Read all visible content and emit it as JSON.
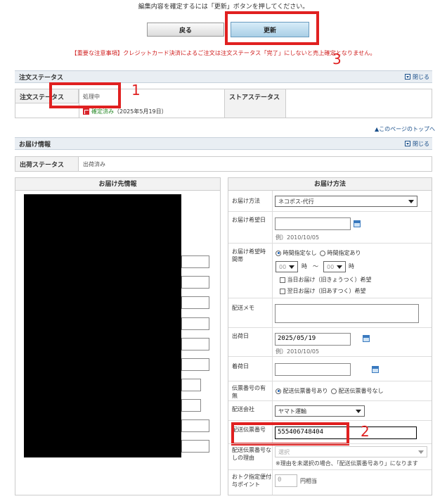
{
  "top_notice": "編集内容を確定するには「更新」ボタンを押してください。",
  "buttons": {
    "back": "戻る",
    "update": "更新"
  },
  "warning": "【重要な注意事項】クレジットカード決済によるご注文は注文ステータス「完了」にしないと売上確定となりません。",
  "annotations": {
    "n1": "1",
    "n2": "2",
    "n3": "3"
  },
  "order_status": {
    "section_title": "注文ステータス",
    "collapse": "閉じる",
    "label": "注文ステータス",
    "value": "処理中",
    "confirmed_text": "確定済み",
    "confirmed_date": "（2025年5月19日）",
    "store_status_label": "ストアステータス"
  },
  "back_to_top": "▲このページのトップへ",
  "delivery": {
    "section_title": "お届け情報",
    "collapse": "閉じる",
    "ship_status_label": "出荷ステータス",
    "ship_status_value": "出荷済み",
    "left_header": "お届け先情報",
    "right_header": "お届け方法"
  },
  "method": {
    "method_label": "お届け方法",
    "method_value": "ネコポス-代行",
    "desired_date_label": "お届け希望日",
    "date_example": "例）2010/10/05",
    "desired_time_label": "お届け希望時間帯",
    "time_none": "時間指定なし",
    "time_some": "時間指定あり",
    "hour_placeholder": "00",
    "hour_unit": "時",
    "tilde": "〜",
    "same_day": "当日お届け（旧きょうつく）希望",
    "next_day": "翌日お届け（旧あすつく）希望",
    "memo_label": "配送メモ",
    "ship_date_label": "出荷日",
    "ship_date_value": "2025/05/19",
    "ship_date_example": "例）2010/10/05",
    "arrival_label": "着荷日",
    "slip_presence_label": "伝票番号の有無",
    "slip_yes": "配送伝票番号あり",
    "slip_no": "配送伝票番号なし",
    "carrier_label": "配送会社",
    "carrier_value": "ヤマト運輸",
    "slip_number_label": "配送伝票番号",
    "slip_number_value": "555406748404",
    "no_slip_reason_label": "配送伝票番号なしの理由",
    "no_slip_reason_placeholder": "選択",
    "no_slip_reason_note": "※理由を未選択の場合、「配送伝票番号あり」になります",
    "point_label": "おトク指定便付与ポイント",
    "point_value": "0",
    "point_unit": "円相当"
  }
}
